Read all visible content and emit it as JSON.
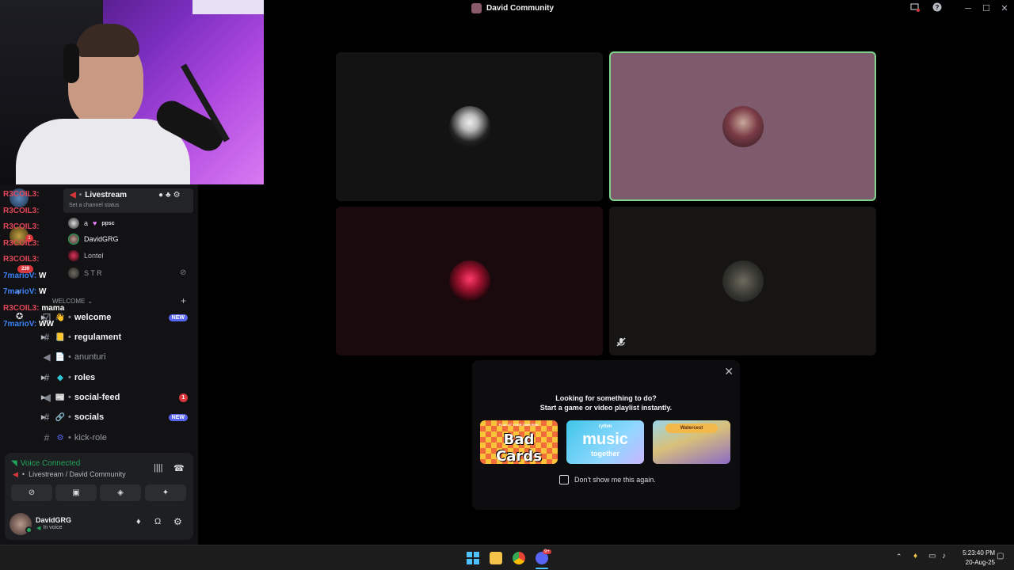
{
  "window": {
    "title": "David Community"
  },
  "stream_overlay": {
    "chat": [
      {
        "user": "R3COIL3:",
        "message": "",
        "color": "#e2465a"
      },
      {
        "user": "R3COIL3:",
        "message": "",
        "color": "#e2465a"
      },
      {
        "user": "R3COIL3:",
        "message": "",
        "color": "#e2465a"
      },
      {
        "user": "R3COIL3:",
        "message": "",
        "color": "#e2465a"
      },
      {
        "user": "R3COIL3:",
        "message": "",
        "color": "#e2465a"
      },
      {
        "user": "7marioV:",
        "message": "W",
        "color": "#3b82f6"
      },
      {
        "user": "7marioV:",
        "message": "W",
        "color": "#3b82f6"
      },
      {
        "user": "R3COIL3:",
        "message": "mama",
        "color": "#e2465a"
      },
      {
        "user": "7marioV:",
        "message": "WW",
        "color": "#3b82f6"
      }
    ],
    "server_badges": [
      "1",
      "239"
    ]
  },
  "voice_channel": {
    "name": "Livestream",
    "status_placeholder": "Set a channel status",
    "members": [
      {
        "name": "a",
        "tag": "ppsc"
      },
      {
        "name": "DavidGRG"
      },
      {
        "name": "Lontel"
      },
      {
        "name": "S T R"
      }
    ]
  },
  "category": {
    "name": "WELCOME"
  },
  "channels": [
    {
      "name": "welcome",
      "emoji": "👋",
      "badge": "NEW",
      "bold": true
    },
    {
      "name": "regulament",
      "emoji": "📒",
      "bold": true
    },
    {
      "name": "anunturi",
      "emoji": "📄",
      "bold": false
    },
    {
      "name": "roles",
      "emoji": "◆",
      "bold": true
    },
    {
      "name": "social-feed",
      "emoji": "📰",
      "count": "1",
      "bold": true
    },
    {
      "name": "socials",
      "emoji": "🔗",
      "badge": "NEW",
      "bold": true
    },
    {
      "name": "kick-role",
      "emoji": "⚙",
      "bold": false
    }
  ],
  "voice_panel": {
    "status": "Voice Connected",
    "location": "Livestream / David Community"
  },
  "user_panel": {
    "name": "DavidGRG",
    "status": "In voice"
  },
  "popup": {
    "line1": "Looking for something to do?",
    "line2": "Start a game or video playlist instantly.",
    "cards": [
      {
        "top": "PLAY AT YOUR OWN RISK",
        "title": "Bad Cards"
      },
      {
        "top": "rythm",
        "title": "music",
        "sub": "together"
      },
      {
        "top": "",
        "title": "Watercest"
      }
    ],
    "checkbox_label": "Don't show me this again."
  },
  "taskbar": {
    "time": "5:23:40 PM",
    "date": "20-Aug-25",
    "discord_badge": "9+"
  },
  "colors": {
    "accent": "#5865f2",
    "voice_green": "#23a55a",
    "speaking_border": "#7ed38d"
  }
}
